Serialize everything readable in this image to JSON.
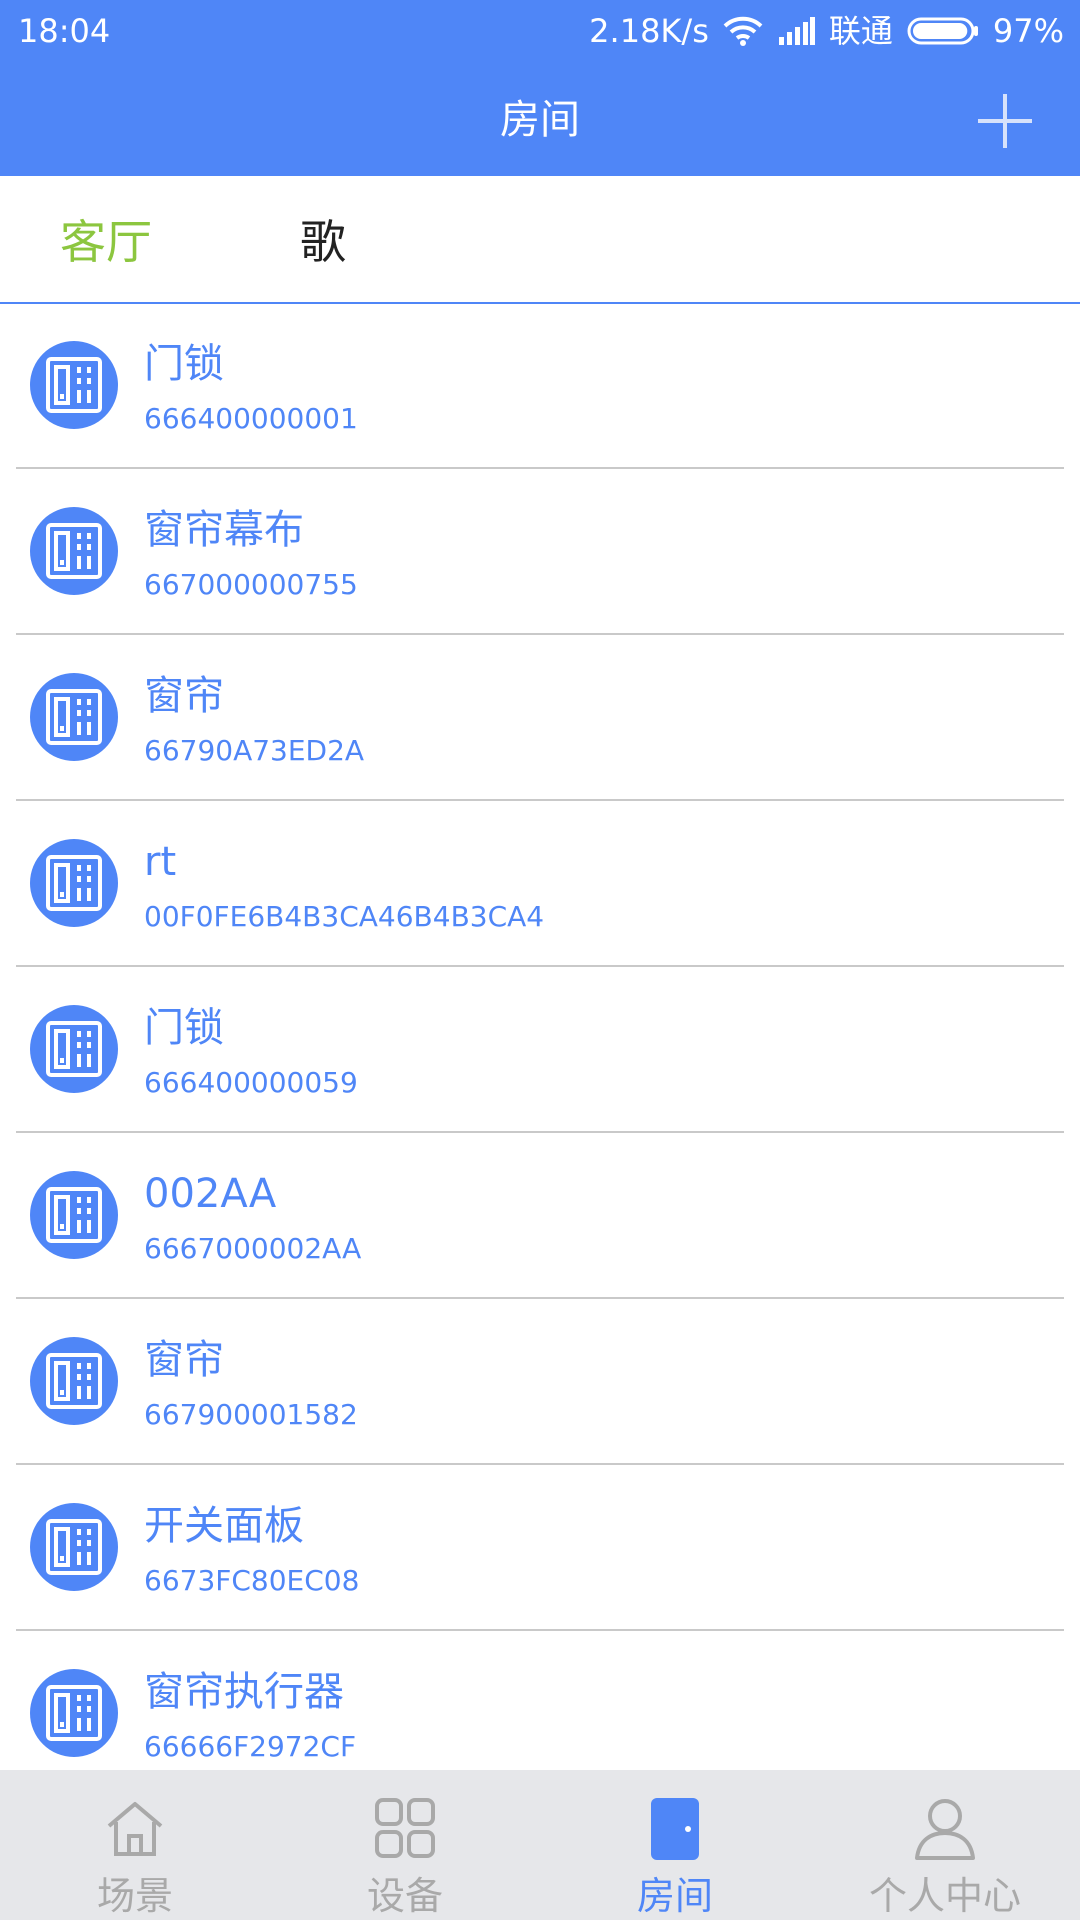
{
  "status": {
    "time": "18:04",
    "speed": "2.18K/s",
    "carrier": "联通",
    "battery": "97%",
    "battery_level": 0.97
  },
  "header": {
    "title": "房间",
    "add_icon": "plus-icon"
  },
  "tabs": [
    {
      "label": "客厅",
      "active": true
    },
    {
      "label": "歌",
      "active": false
    }
  ],
  "devices": [
    {
      "name": "门锁",
      "code": "666400000001",
      "icon": "switch-panel-icon"
    },
    {
      "name": "窗帘幕布",
      "code": "667000000755",
      "icon": "switch-panel-icon"
    },
    {
      "name": "窗帘",
      "code": "66790A73ED2A",
      "icon": "switch-panel-icon"
    },
    {
      "name": "rt",
      "code": "00F0FE6B4B3CA46B4B3CA4",
      "icon": "switch-panel-icon"
    },
    {
      "name": "门锁",
      "code": "666400000059",
      "icon": "switch-panel-icon"
    },
    {
      "name": "002AA",
      "code": "6667000002AA",
      "icon": "switch-panel-icon"
    },
    {
      "name": "窗帘",
      "code": "667900001582",
      "icon": "switch-panel-icon"
    },
    {
      "name": "开关面板",
      "code": "6673FC80EC08",
      "icon": "switch-panel-icon"
    },
    {
      "name": "窗帘执行器",
      "code": "66666F2972CF",
      "icon": "switch-panel-icon"
    }
  ],
  "nav": [
    {
      "label": "场景",
      "icon": "home-icon",
      "active": false
    },
    {
      "label": "设备",
      "icon": "grid-icon",
      "active": false
    },
    {
      "label": "房间",
      "icon": "door-icon",
      "active": true
    },
    {
      "label": "个人中心",
      "icon": "user-icon",
      "active": false
    }
  ],
  "colors": {
    "primary": "#4f86f7",
    "active_tab": "#8cc63f",
    "nav_inactive": "#a9a9a9",
    "divider": "#c9c9c9"
  }
}
